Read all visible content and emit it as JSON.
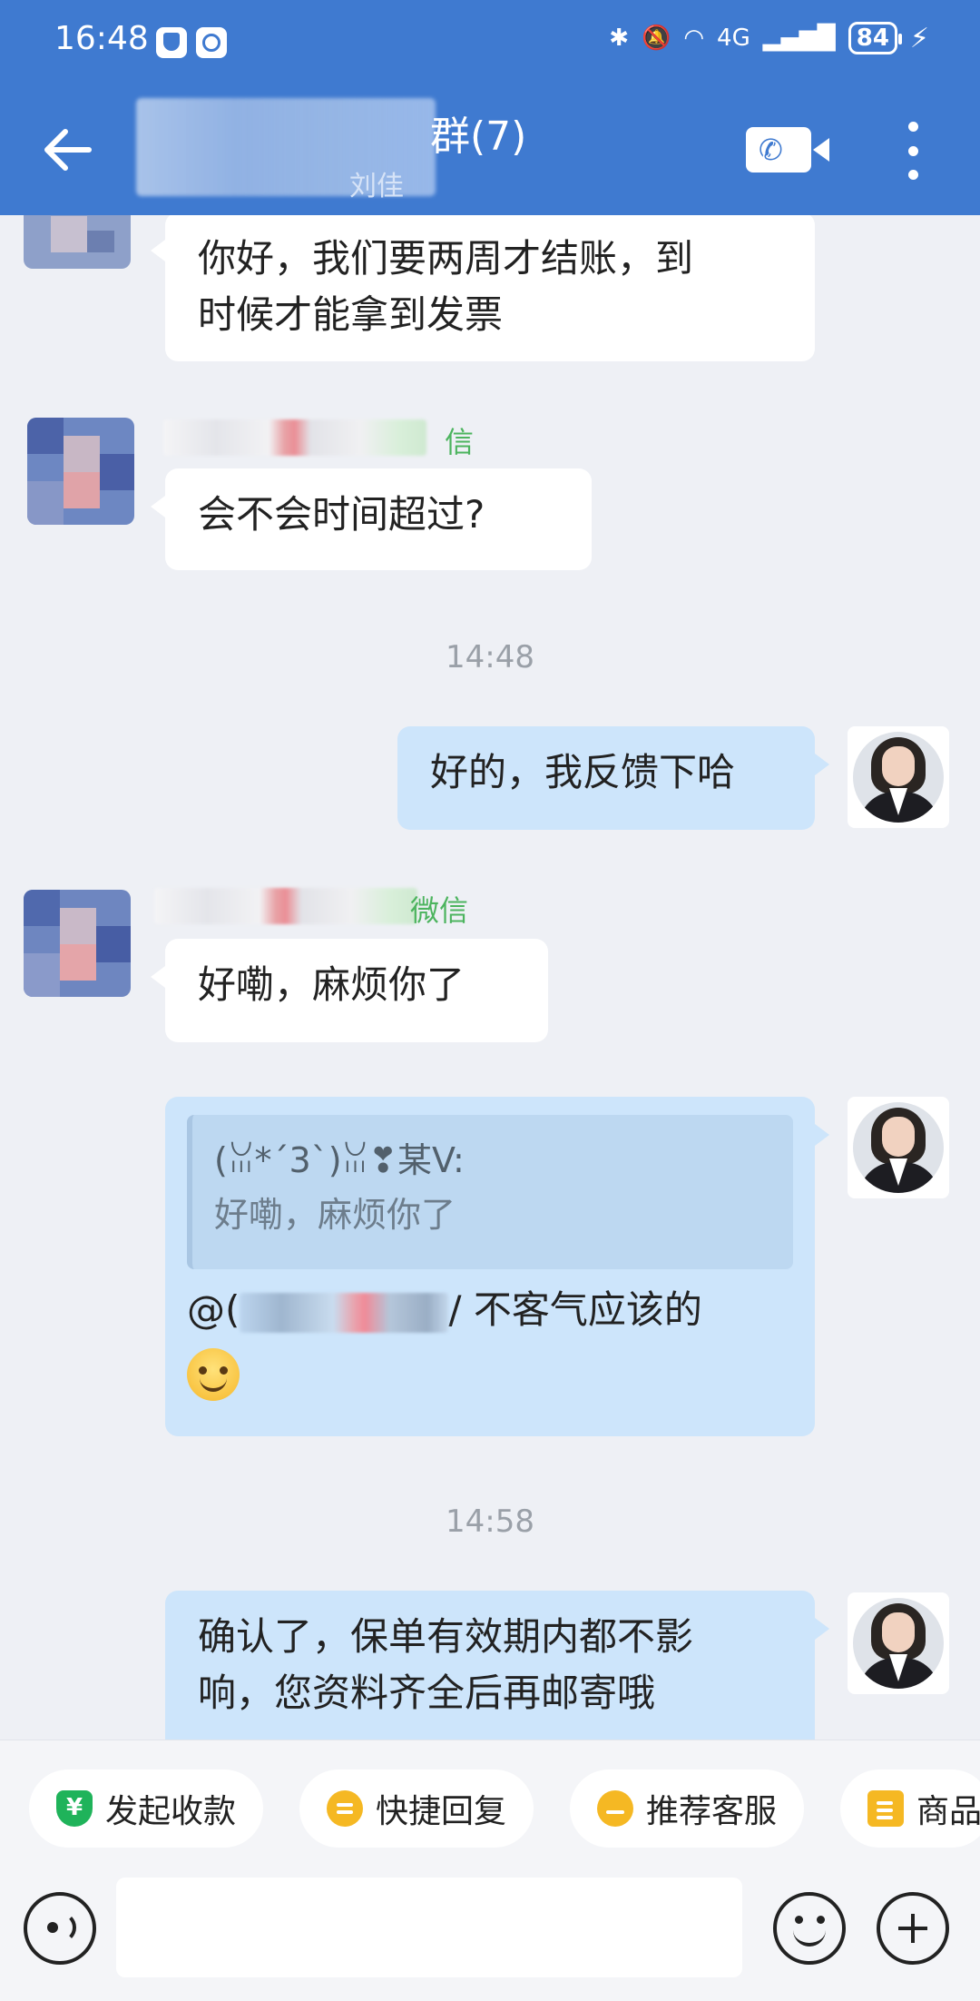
{
  "status_bar": {
    "time": "16:48",
    "network": "4G",
    "battery": "84"
  },
  "header": {
    "title": "群(7)",
    "subtitle": "刘佳",
    "back_icon": "arrow-left-icon",
    "call_icon": "video-call-icon",
    "more_icon": "more-vertical-icon"
  },
  "messages": {
    "m1": {
      "text_line1": "你好，我们要两周才结账，到",
      "text_line2": "时候才能拿到发票"
    },
    "m2": {
      "sender_suffix": "信",
      "text": "会不会时间超过?"
    },
    "time1": "14:48",
    "m3": {
      "text": "好的，我反馈下哈"
    },
    "m4": {
      "sender_suffix": "微信",
      "text": "好嘞，麻烦你了"
    },
    "m5": {
      "quote_name": "(ꈍ*´3`)ꈍ❣某V:",
      "quote_text": "好嘞，麻烦你了",
      "mention_prefix": "@(",
      "mention_suffix": "/ 不客气应该的"
    },
    "time2": "14:58",
    "m6": {
      "text_line1": "确认了，保单有效期内都不影",
      "text_line2": "响，您资料齐全后再邮寄哦"
    }
  },
  "quick_actions": {
    "collect": "发起收款",
    "quick_reply": "快捷回复",
    "recommend": "推荐客服",
    "goods": "商品"
  },
  "input": {
    "placeholder": ""
  },
  "colors": {
    "header_bg": "#3f7ad0",
    "bubble_out": "#cde5fb",
    "bubble_in": "#ffffff",
    "sender_green": "#4cb45e"
  }
}
